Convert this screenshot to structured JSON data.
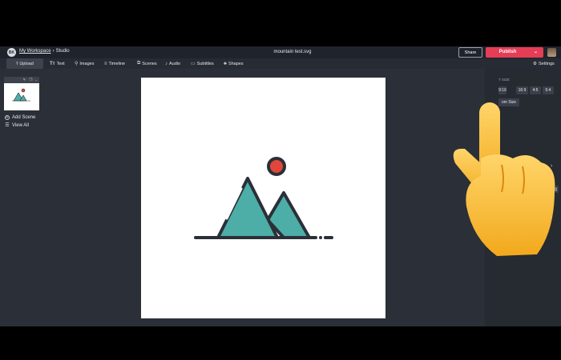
{
  "header": {
    "workspace_logo": "BK",
    "workspace_link": "My Workspace",
    "separator": "›",
    "section": "Studio",
    "file_title": "mountain test.svg",
    "share_label": "Share",
    "publish_label": "Publish",
    "publish_caret": "⌄"
  },
  "toolbar": {
    "upload": "Upload",
    "text": "Text",
    "images": "Images",
    "timeline": "Timeline",
    "scenes": "Scenes",
    "audio": "Audio",
    "subtitles": "Subtitles",
    "shapes": "Shapes",
    "settings": "Settings"
  },
  "left_panel": {
    "add_scene": "Add Scene",
    "view_all": "View All"
  },
  "right_panel": {
    "size_header": "T SIZE",
    "ratios": [
      "9:16",
      "16:9",
      "4:5",
      "5:4"
    ],
    "custom_size": "om Size"
  },
  "colors": {
    "accent": "#e53d56",
    "teal": "#4daea8",
    "sun": "#e0473a",
    "stroke": "#2b2f38"
  },
  "icons": [
    "upload-icon",
    "text-icon",
    "search-icon",
    "timeline-icon",
    "scenes-icon",
    "audio-icon",
    "subtitles-icon",
    "shapes-icon",
    "gear-icon",
    "plus-circle-icon",
    "list-icon",
    "chevron-down-icon",
    "trash-icon",
    "pointing-hand-emoji"
  ]
}
